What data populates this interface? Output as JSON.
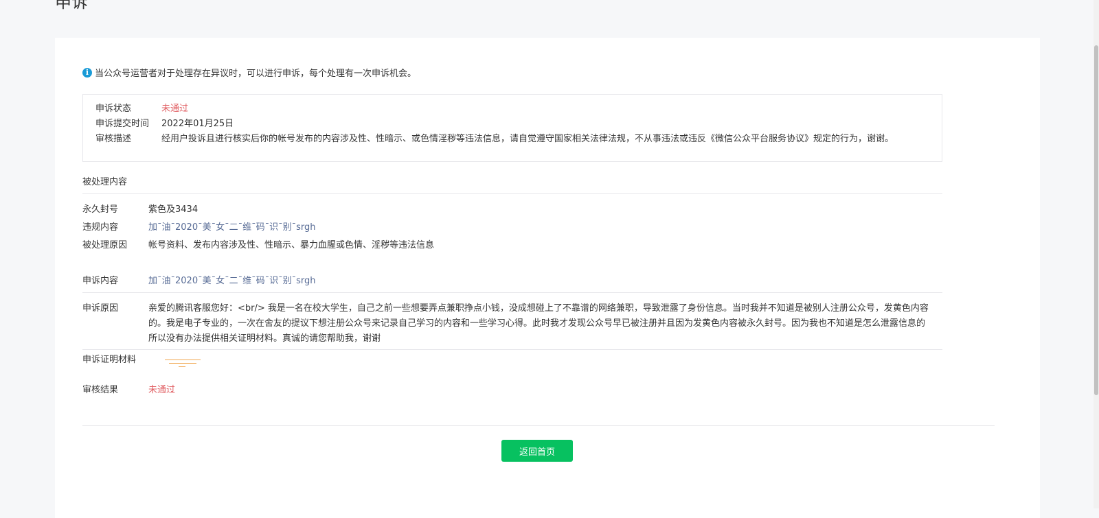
{
  "page": {
    "title": "申诉"
  },
  "notice": {
    "icon": "info-icon",
    "text": "当公众号运营者对于处理存在异议时，可以进行申诉，每个处理有一次申诉机会。"
  },
  "status": {
    "state_label": "申诉状态",
    "state_value": "未通过",
    "submit_label": "申诉提交时间",
    "submit_value": "2022年01月25日",
    "desc_label": "审核描述",
    "desc_value": "经用户投诉且进行核实后你的帐号发布的内容涉及性、性暗示、或色情淫秽等违法信息，请自觉遵守国家相关法律法规，不从事违法或违反《微信公众平台服务协议》规定的行为，谢谢。"
  },
  "handled": {
    "section_title": "被处理内容",
    "ban_label": "永久封号",
    "ban_value": "紫色及3434",
    "violation_label": "违规内容",
    "violation_value": "加¯油¯2020¯美¯女¯二¯维¯码¯识¯别¯srgh",
    "reason_label": "被处理原因",
    "reason_value": "帐号资料、发布内容涉及性、性暗示、暴力血腥或色情、淫秽等违法信息"
  },
  "appeal": {
    "content_label": "申诉内容",
    "content_value": "加¯油¯2020¯美¯女¯二¯维¯码¯识¯别¯srgh",
    "reason_label": "申诉原因",
    "reason_value": "亲爱的腾讯客服您好：<br/>  我是一名在校大学生，自己之前一些想要弄点兼职挣点小钱，没成想碰上了不靠谱的网络兼职，导致泄露了身份信息。当时我并不知道是被别人注册公众号，发黄色内容的。我是电子专业的，一次在舍友的提议下想注册公众号来记录自己学习的内容和一些学习心得。此时我才发现公众号早已被注册并且因为发黄色内容被永久封号。因为我也不知道是怎么泄露信息的所以没有办法提供相关证明材料。真诚的请您帮助我，谢谢",
    "proof_label": "申诉证明材料",
    "result_label": "审核结果",
    "result_value": "未通过"
  },
  "actions": {
    "back_label": "返回首页"
  },
  "colors": {
    "primary": "#07c160",
    "error": "#e15f63",
    "link": "#576b95",
    "info": "#1a9bd7"
  }
}
